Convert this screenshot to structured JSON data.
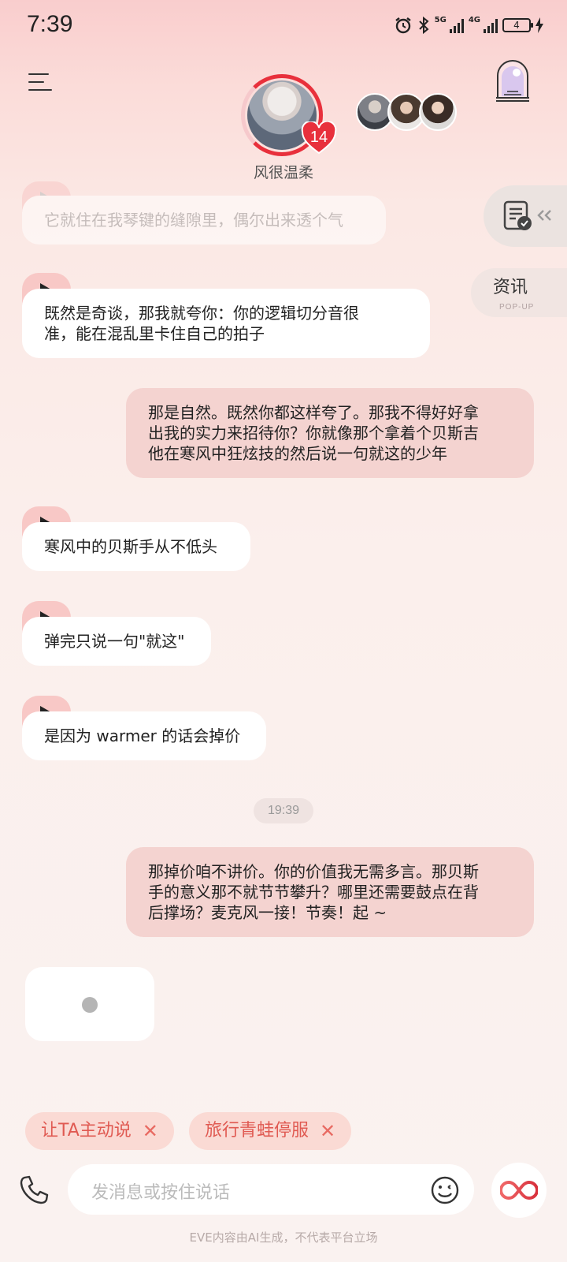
{
  "status_bar": {
    "time": "7:39",
    "net1": "5G",
    "net2": "4G",
    "battery": "4"
  },
  "header": {
    "character_name": "风很温柔",
    "affinity_level": "14"
  },
  "side": {
    "news_label": "资讯",
    "news_sublabel": "POP-UP"
  },
  "messages": {
    "m0": "它就住在我琴键的缝隙里，偶尔出来透个气",
    "m1_line1": "既然是奇谈，那我就夸你：你的逻辑切分音很",
    "m1_line2": "准，能在混乱里卡住自己的拍子",
    "u1_line1": "那是自然。既然你都这样夸了。那我不得好好拿",
    "u1_line2": "出我的实力来招待你？你就像那个拿着个贝斯吉",
    "u1_line3": "他在寒风中狂炫技的然后说一句就这的少年",
    "m2": "寒风中的贝斯手从不低头",
    "m3": "弹完只说一句\"就这\"",
    "m4": "是因为 warmer 的话会掉价",
    "timestamp": "19:39",
    "u2_line1": "那掉价咱不讲价。你的价值我无需多言。那贝斯",
    "u2_line2": "手的意义那不就节节攀升？哪里还需要鼓点在背",
    "u2_line3": "后撑场？麦克风一接！节奏！起 ~"
  },
  "chips": [
    {
      "label": "让TA主动说",
      "close": "✕"
    },
    {
      "label": "旅行青蛙停服",
      "close": "✕"
    }
  ],
  "input": {
    "placeholder": "发消息或按住说话"
  },
  "footer": {
    "disclaimer": "EVE内容由AI生成，不代表平台立场"
  },
  "colors": {
    "accent": "#e8303c",
    "user_bubble": "#f4d3d0",
    "chip_bg": "#fadad4",
    "chip_text": "#e05a52"
  },
  "icons": [
    "menu-icon",
    "castle-icon",
    "alarm-icon",
    "bluetooth-icon",
    "play-icon",
    "document-check-icon",
    "phone-icon",
    "emoji-icon",
    "infinity-icon"
  ]
}
